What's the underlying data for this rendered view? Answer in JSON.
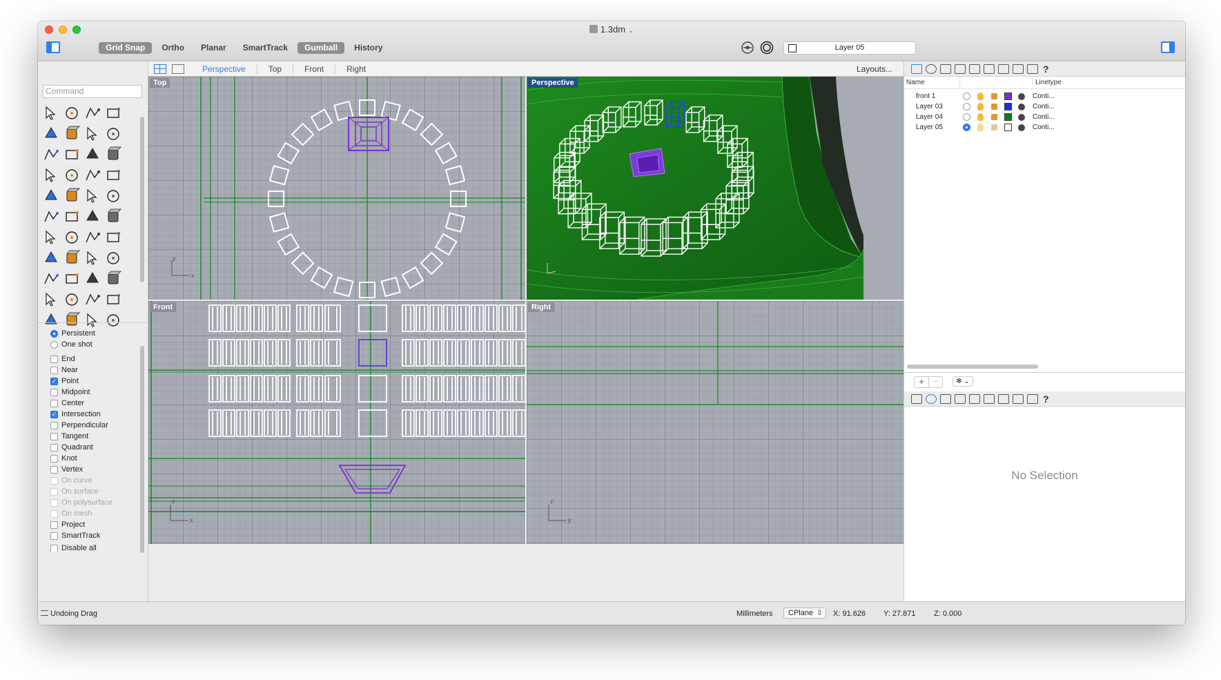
{
  "window": {
    "title": "1.3dm",
    "title_suffix": "⌄"
  },
  "toolbar": {
    "modes": [
      {
        "label": "Grid Snap",
        "active": true
      },
      {
        "label": "Ortho",
        "active": false
      },
      {
        "label": "Planar",
        "active": false
      },
      {
        "label": "SmartTrack",
        "active": false
      },
      {
        "label": "Gumball",
        "active": true
      },
      {
        "label": "History",
        "active": false
      }
    ],
    "current_layer": "Layer 05"
  },
  "command": {
    "placeholder": "Command"
  },
  "osnap": {
    "radios": [
      {
        "label": "Persistent",
        "on": true
      },
      {
        "label": "One shot",
        "on": false
      }
    ],
    "checks": [
      {
        "label": "End",
        "on": false,
        "enabled": true
      },
      {
        "label": "Near",
        "on": false,
        "enabled": true
      },
      {
        "label": "Point",
        "on": true,
        "enabled": true
      },
      {
        "label": "Midpoint",
        "on": false,
        "enabled": true
      },
      {
        "label": "Center",
        "on": false,
        "enabled": true
      },
      {
        "label": "Intersection",
        "on": true,
        "enabled": true
      },
      {
        "label": "Perpendicular",
        "on": false,
        "enabled": true
      },
      {
        "label": "Tangent",
        "on": false,
        "enabled": true
      },
      {
        "label": "Quadrant",
        "on": false,
        "enabled": true
      },
      {
        "label": "Knot",
        "on": false,
        "enabled": true
      },
      {
        "label": "Vertex",
        "on": false,
        "enabled": true
      },
      {
        "label": "On curve",
        "on": false,
        "enabled": false
      },
      {
        "label": "On surface",
        "on": false,
        "enabled": false
      },
      {
        "label": "On polysurface",
        "on": false,
        "enabled": false
      },
      {
        "label": "On mesh",
        "on": false,
        "enabled": false
      },
      {
        "label": "Project",
        "on": false,
        "enabled": true
      },
      {
        "label": "SmartTrack",
        "on": false,
        "enabled": true
      }
    ],
    "disable_all": "Disable all"
  },
  "viewport_tabs": {
    "tabs": [
      "Perspective",
      "Top",
      "Front",
      "Right"
    ],
    "active": "Perspective",
    "layouts": "Layouts..."
  },
  "viewports": {
    "top": "Top",
    "perspective": "Perspective",
    "front": "Front",
    "right": "Right",
    "axis_x": "x",
    "axis_y": "y",
    "axis_z": "z"
  },
  "layers": {
    "header": {
      "name": "Name",
      "linetype": "Linetype"
    },
    "rows": [
      {
        "name": "front 1",
        "current": false,
        "color": "#7b2fd0",
        "linetype": "Conti..."
      },
      {
        "name": "Layer 03",
        "current": false,
        "color": "#1730e6",
        "linetype": "Conti..."
      },
      {
        "name": "Layer 04",
        "current": false,
        "color": "#0f7f1a",
        "linetype": "Conti..."
      },
      {
        "name": "Layer 05",
        "current": true,
        "color": "#ffffff",
        "linetype": "Conti..."
      }
    ]
  },
  "properties": {
    "empty": "No Selection"
  },
  "status": {
    "message": "Undoing Drag",
    "units": "Millimeters",
    "cplane": "CPlane",
    "x": "X: 91.626",
    "y": "Y: 27.871",
    "z": "Z: 0.000"
  },
  "colors": {
    "accent": "#2d7ff0",
    "viewport_bg": "#a7abb3",
    "wire": "#ffffff",
    "object_purple": "#7b2fd0",
    "axis_green": "#118a1d"
  },
  "icons": {
    "toolbox": [
      "select-arrow-icon",
      "point-icon",
      "polyline-icon",
      "curve-icon",
      "circle-icon",
      "ellipse-icon",
      "polygon-icon",
      "rectangle-icon",
      "arc-icon",
      "fillet-curve-icon",
      "surface-icon",
      "sweep-icon",
      "box-icon",
      "sphere-icon",
      "cylinder-icon",
      "extrude-icon",
      "boolean-icon",
      "explode-icon",
      "trim-icon",
      "split-icon",
      "fillet-edge-icon",
      "mesh-icon",
      "join-icon",
      "move-icon",
      "text-icon",
      "dimension-icon",
      "array-icon",
      "scale-icon",
      "solid-edit-icon",
      "array-grid-icon",
      "history-icon",
      "rotate-icon",
      "analyze-icon",
      "check-icon",
      "render-icon",
      "paint-icon",
      "zoom-icon",
      "zoom-window-icon",
      "zoom-extents-icon",
      "zoom-selected-icon",
      "rotate-view-icon",
      "car-icon",
      "ortho-view-icon",
      "pan-icon"
    ]
  }
}
